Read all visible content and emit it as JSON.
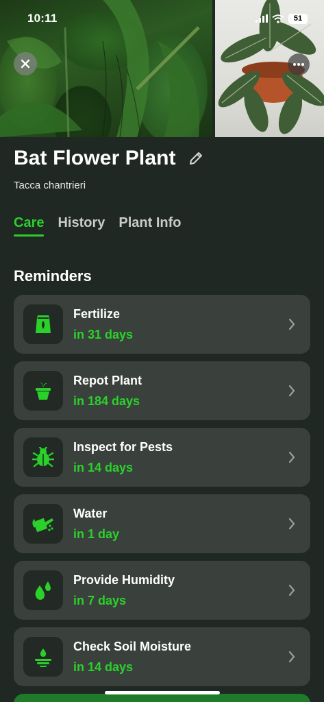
{
  "status_bar": {
    "time": "10:11",
    "battery": "51"
  },
  "plant": {
    "name": "Bat Flower Plant",
    "scientific_name": "Tacca chantrieri"
  },
  "tabs": [
    {
      "label": "Care",
      "active": true
    },
    {
      "label": "History",
      "active": false
    },
    {
      "label": "Plant Info",
      "active": false
    }
  ],
  "reminders_title": "Reminders",
  "reminders": [
    {
      "name": "Fertilize",
      "due": "in 31 days",
      "icon": "fertilizer-bag-icon"
    },
    {
      "name": "Repot Plant",
      "due": "in 184 days",
      "icon": "plant-pot-icon"
    },
    {
      "name": "Inspect for Pests",
      "due": "in 14 days",
      "icon": "bug-icon"
    },
    {
      "name": "Water",
      "due": "in 1 day",
      "icon": "watering-can-icon"
    },
    {
      "name": "Provide Humidity",
      "due": "in 7 days",
      "icon": "water-drops-icon"
    },
    {
      "name": "Check Soil Moisture",
      "due": "in 14 days",
      "icon": "soil-moisture-icon"
    }
  ],
  "colors": {
    "accent": "#2bd12b",
    "background": "#202823",
    "card": "#3a413c",
    "icon_tile": "#232a25"
  }
}
